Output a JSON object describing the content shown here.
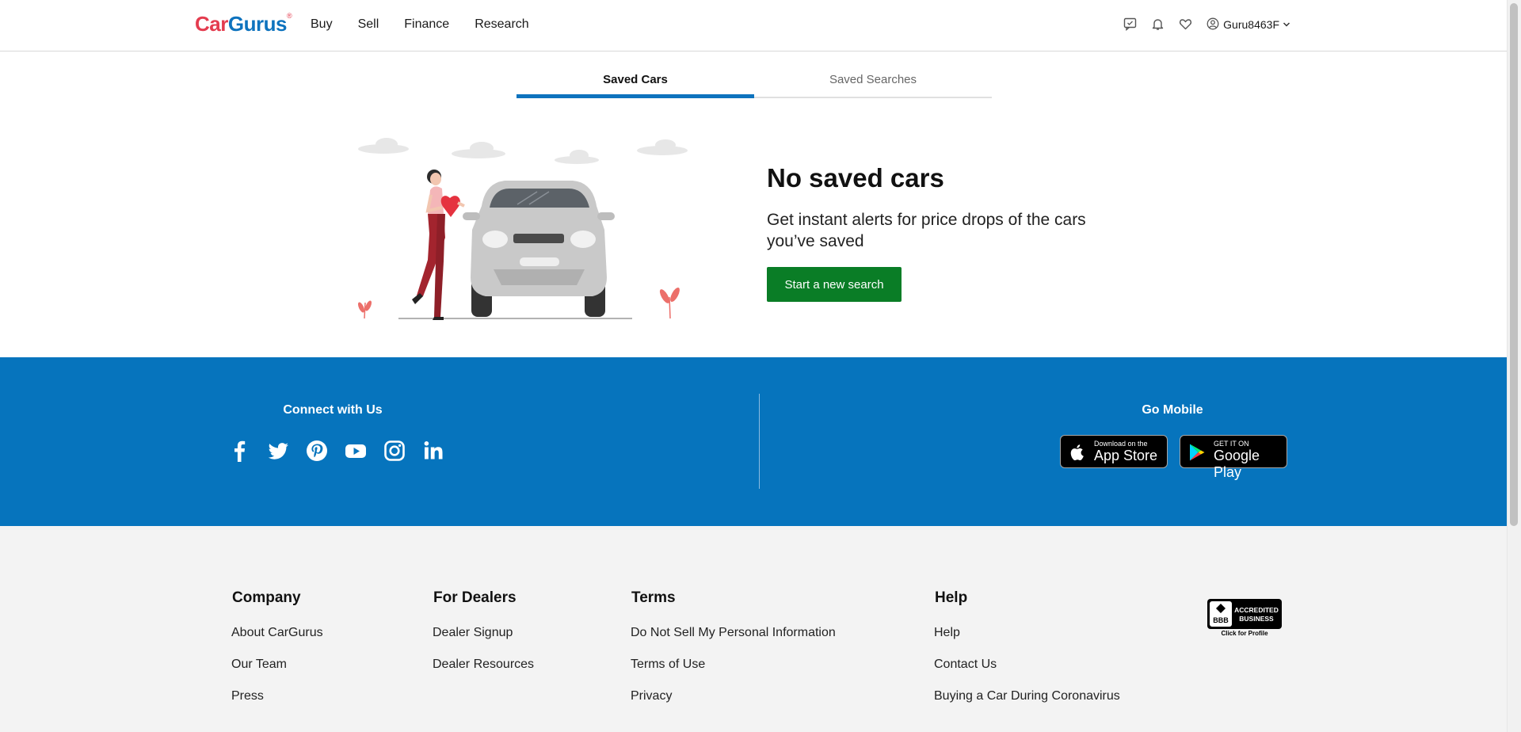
{
  "header": {
    "logo": {
      "part1": "Car",
      "part2": "Gurus",
      "mark": "®"
    },
    "nav": [
      "Buy",
      "Sell",
      "Finance",
      "Research"
    ],
    "icons": [
      "chat-icon",
      "bell-icon",
      "heart-icon",
      "user-circle-icon"
    ],
    "username": "Guru8463F"
  },
  "tabs": {
    "saved_cars": "Saved Cars",
    "saved_searches": "Saved Searches",
    "active": "Saved Cars"
  },
  "empty_state": {
    "title": "No saved cars",
    "subtitle": "Get instant alerts for price drops of the cars you’ve saved",
    "button": "Start a new search"
  },
  "connect": {
    "title": "Connect with Us",
    "social_icons": [
      "facebook-icon",
      "twitter-icon",
      "pinterest-icon",
      "youtube-icon",
      "instagram-icon",
      "linkedin-icon"
    ]
  },
  "mobile": {
    "title": "Go Mobile",
    "app_store": {
      "small": "Download on the",
      "big": "App Store"
    },
    "google_play": {
      "small": "GET IT ON",
      "big": "Google Play"
    }
  },
  "footer": {
    "company": {
      "title": "Company",
      "links": [
        "About CarGurus",
        "Our Team",
        "Press"
      ]
    },
    "dealers": {
      "title": "For Dealers",
      "links": [
        "Dealer Signup",
        "Dealer Resources"
      ]
    },
    "terms": {
      "title": "Terms",
      "links": [
        "Do Not Sell My Personal Information",
        "Terms of Use",
        "Privacy"
      ]
    },
    "help": {
      "title": "Help",
      "links": [
        "Help",
        "Contact Us",
        "Buying a Car During Coronavirus"
      ]
    },
    "bbb": {
      "line1": "ACCREDITED",
      "line2": "BUSINESS",
      "caption": "Click for Profile",
      "mark": "BBB"
    }
  },
  "colors": {
    "brand_blue": "#0674bd",
    "cta_green": "#0a7d26",
    "logo_red": "#e43c4f"
  }
}
